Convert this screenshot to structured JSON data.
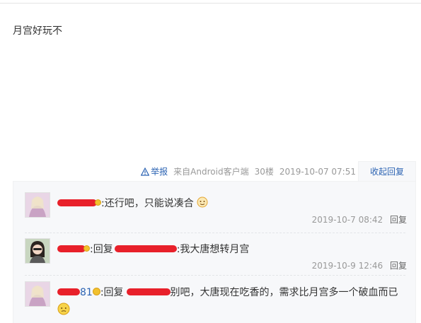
{
  "post": {
    "content": "月宫好玩不",
    "report_label": "举报",
    "source": "来自Android客户端",
    "floor": "30楼",
    "time": "2019-10-07 07:51",
    "collapse_label": "收起回复"
  },
  "replies": [
    {
      "text": ":还行吧，只能说凑合",
      "time": "2019-10-7 08:42",
      "reply_label": "回复"
    },
    {
      "prefix": ":回复",
      "text": ":我大唐想转月宫",
      "time": "2019-10-9 12:46",
      "reply_label": "回复"
    },
    {
      "name_suffix": "81",
      "prefix": ":回复",
      "text": "别吧，大唐现在吃香的，需求比月宫多一个破血而已"
    }
  ],
  "colors": {
    "link": "#2d64b3",
    "meta": "#999999",
    "reply_bg": "#f7f8fa",
    "redaction": "#e8202a"
  },
  "icons": [
    "warning-triangle-icon",
    "smile-emoji-icon",
    "ghost-emoji-icon",
    "shy-emoji-icon"
  ]
}
